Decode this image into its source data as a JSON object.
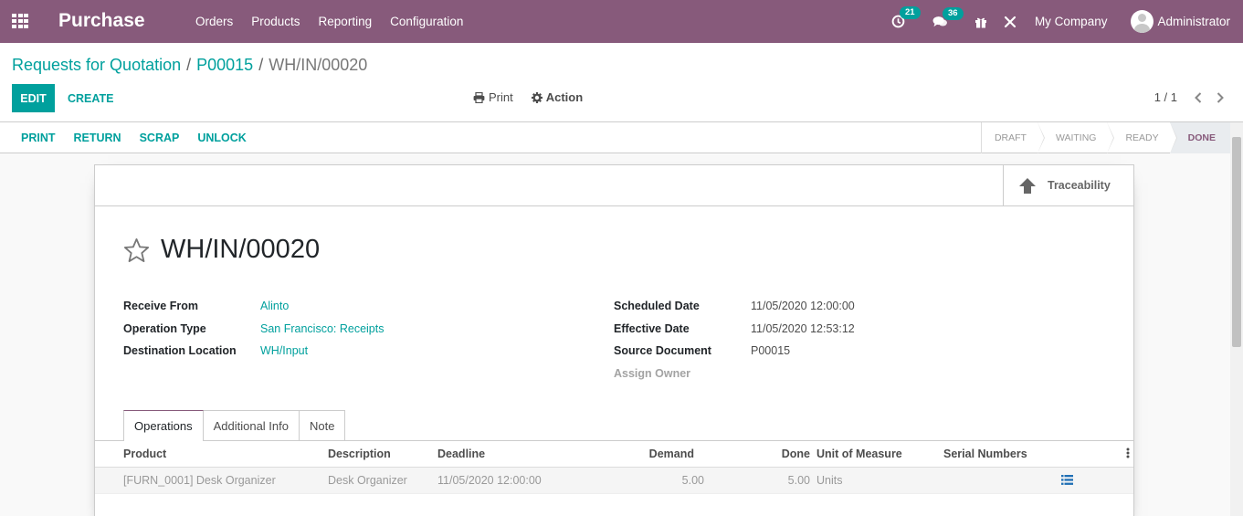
{
  "navbar": {
    "app_name": "Purchase",
    "menu": [
      "Orders",
      "Products",
      "Reporting",
      "Configuration"
    ],
    "activity_count": "21",
    "messages_count": "36",
    "company": "My Company",
    "user": "Administrator",
    "bg_color": "#875a7b"
  },
  "breadcrumb": {
    "items": [
      "Requests for Quotation",
      "P00015"
    ],
    "current": "WH/IN/00020",
    "separator": "/"
  },
  "control_panel": {
    "edit_label": "EDIT",
    "create_label": "CREATE",
    "print_label": "Print",
    "action_label": "Action",
    "pager": "1 / 1"
  },
  "statusbar": {
    "buttons": [
      "PRINT",
      "RETURN",
      "SCRAP",
      "UNLOCK"
    ],
    "steps": [
      "DRAFT",
      "WAITING",
      "READY",
      "DONE"
    ],
    "current_step": "DONE"
  },
  "form": {
    "smart_button": "Traceability",
    "title": "WH/IN/00020",
    "left_fields": [
      {
        "label": "Receive From",
        "value": "Alinto"
      },
      {
        "label": "Operation Type",
        "value": "San Francisco: Receipts"
      },
      {
        "label": "Destination Location",
        "value": "WH/Input"
      }
    ],
    "right_fields": [
      {
        "label": "Scheduled Date",
        "value": "11/05/2020 12:00:00"
      },
      {
        "label": "Effective Date",
        "value": "11/05/2020 12:53:12"
      },
      {
        "label": "Source Document",
        "value": "P00015"
      },
      {
        "label": "Assign Owner",
        "value": ""
      }
    ],
    "tabs": [
      "Operations",
      "Additional Info",
      "Note"
    ],
    "table": {
      "headers": {
        "product": "Product",
        "description": "Description",
        "deadline": "Deadline",
        "demand": "Demand",
        "done": "Done",
        "uom": "Unit of Measure",
        "serial": "Serial Numbers"
      },
      "rows": [
        {
          "product": "[FURN_0001] Desk Organizer",
          "description": "Desk Organizer",
          "deadline": "11/05/2020 12:00:00",
          "demand": "5.00",
          "done": "5.00",
          "uom": "Units"
        }
      ]
    }
  }
}
